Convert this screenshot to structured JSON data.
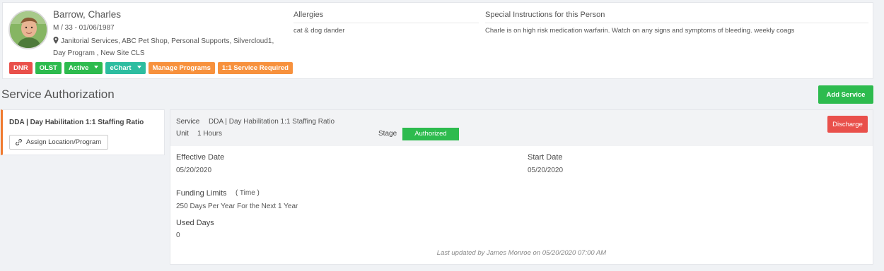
{
  "person": {
    "name": "Barrow, Charles",
    "demographics": "M  /  33 - 01/06/1987",
    "programs": "Janitorial Services, ABC Pet Shop, Personal Supports, Silvercloud1, Day Program , New Site CLS",
    "avatar_icon": "person-photo"
  },
  "badges": {
    "dnr": "DNR",
    "olst": "OLST",
    "status": "Active",
    "echart": "eChart",
    "manage_programs": "Manage Programs",
    "service_required": "1:1 Service Required"
  },
  "allergies": {
    "heading": "Allergies",
    "text": "cat & dog dander"
  },
  "special_instructions": {
    "heading": "Special Instructions for this Person",
    "text": "Charle is on high risk medication warfarin. Watch on any signs and symptoms of bleeding. weekly coags"
  },
  "section": {
    "title": "Service Authorization",
    "add_label": "Add Service"
  },
  "service_list": {
    "item_title": "DDA | Day Habilitation 1:1 Staffing Ratio",
    "assign_label": "Assign Location/Program",
    "assign_icon": "link-icon"
  },
  "detail": {
    "service_label": "Service",
    "service_value": "DDA | Day Habilitation 1:1 Staffing Ratio",
    "unit_label": "Unit",
    "unit_value": "1  Hours",
    "stage_label": "Stage",
    "stage_value": "Authorized",
    "discharge_label": "Discharge",
    "effective_date_label": "Effective Date",
    "effective_date_value": "05/20/2020",
    "start_date_label": "Start Date",
    "start_date_value": "05/20/2020",
    "funding_limits_label": "Funding Limits",
    "funding_limits_type": "( Time )",
    "funding_limits_value": "250 Days Per Year For the Next 1 Year",
    "used_label": "Used  Days",
    "used_value": "0",
    "last_updated": "Last updated by James Monroe on 05/20/2020 07:00 AM"
  },
  "colors": {
    "red": "#e9504b",
    "green": "#2dbb4e",
    "teal": "#2dbda0",
    "orange": "#f7913d",
    "accent_border": "#f07a2f"
  }
}
